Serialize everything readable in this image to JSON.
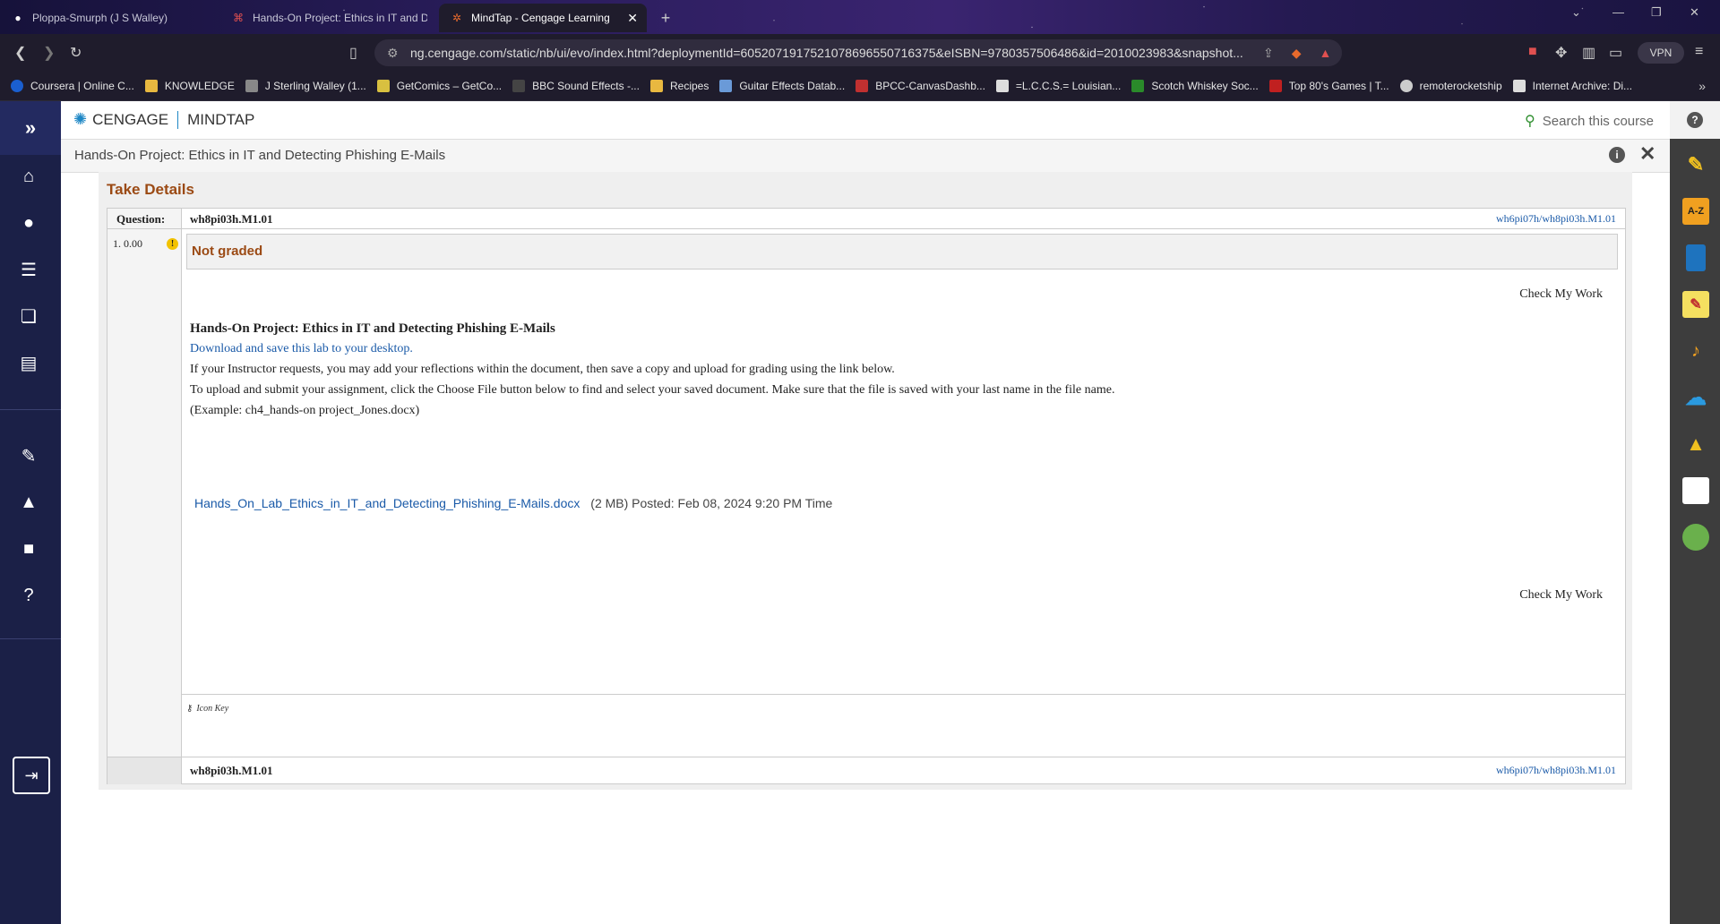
{
  "browser": {
    "tabs": [
      {
        "title": "Ploppa-Smurph (J S Walley)",
        "active": false
      },
      {
        "title": "Hands-On Project: Ethics in IT and D",
        "active": false
      },
      {
        "title": "MindTap - Cengage Learning",
        "active": true
      }
    ],
    "url": "ng.cengage.com/static/nb/ui/evo/index.html?deploymentId=6052071917521078696550716375&eISBN=9780357506486&id=2010023983&snapshot...",
    "vpn_label": "VPN",
    "bookmarks": [
      "Coursera | Online C...",
      "KNOWLEDGE",
      "J Sterling Walley (1...",
      "GetComics – GetCo...",
      "BBC Sound Effects -...",
      "Recipes",
      "Guitar Effects Datab...",
      "BPCC-CanvasDashb...",
      "=L.C.C.S.= Louisian...",
      "Scotch Whiskey Soc...",
      "Top 80's Games | T...",
      "remoterocketship",
      "Internet Archive: Di..."
    ]
  },
  "app": {
    "brand_left": "CENGAGE",
    "brand_right": "MINDTAP",
    "search_placeholder": "Search this course",
    "page_title": "Hands-On Project: Ethics in IT and Detecting Phishing E-Mails"
  },
  "take": {
    "heading": "Take Details",
    "question_label": "Question:",
    "question_id": "wh8pi03h.M1.01",
    "question_link": "wh6pi07h/wh8pi03h.M1.01",
    "score": "1. 0.00",
    "status": "Not graded",
    "check_my_work": "Check My Work",
    "title": "Hands-On Project: Ethics in IT and Detecting Phishing E-Mails",
    "download_text": "Download and save this lab to your desktop.",
    "line1": "If your Instructor requests, you may add your reflections within the document, then save a copy and upload for grading using the link below.",
    "line2": "To upload and submit your assignment, click the Choose File button below to find and select your saved document. Make sure that the file is saved with your last name in the file name.",
    "line3": "(Example: ch4_hands-on project_Jones.docx)",
    "file_name": "Hands_On_Lab_Ethics_in_IT_and_Detecting_Phishing_E-Mails.docx",
    "file_meta": "(2 MB) Posted: Feb 08, 2024 9:20 PM Time",
    "icon_key": "Icon Key",
    "footer_id": "wh8pi03h.M1.01",
    "footer_link": "wh6pi07h/wh8pi03h.M1.01"
  },
  "colors": {
    "accent_brown": "#9b4a14",
    "link_blue": "#1a5aa8",
    "nav_bg": "#1b2047"
  }
}
